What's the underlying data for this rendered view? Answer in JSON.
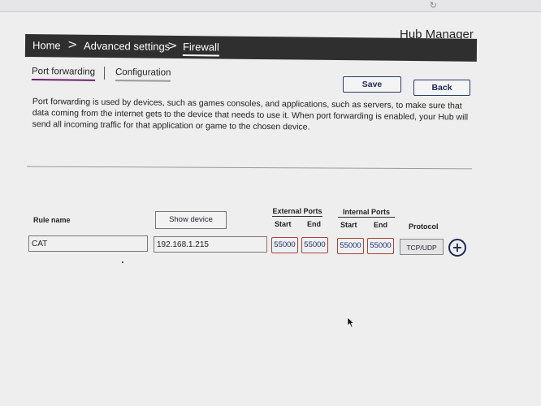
{
  "header": {
    "app_title": "Hub Manager"
  },
  "breadcrumb": {
    "items": [
      "Home",
      "Advanced settings",
      "Firewall"
    ],
    "separator": ">"
  },
  "tabs": [
    {
      "label": "Port forwarding",
      "active": true
    },
    {
      "label": "Configuration",
      "active": false
    }
  ],
  "buttons": {
    "save": "Save",
    "back": "Back"
  },
  "description": "Port forwarding is used by devices, such as games consoles, and applications, such as servers, to make sure that data coming from the internet gets to the device that needs to use it. When port forwarding is enabled, your Hub will send all incoming traffic for that application or game to the chosen device.",
  "table": {
    "rule_name_header": "Rule name",
    "show_device_label": "Show device",
    "external_ports_header": "External Ports",
    "internal_ports_header": "Internal Ports",
    "start_header": "Start",
    "end_header": "End",
    "protocol_header": "Protocol",
    "row": {
      "rule_name": "CAT",
      "device_ip": "192.168.1.215",
      "external_start": "55000",
      "external_end": "55000",
      "internal_start": "55000",
      "internal_end": "55000",
      "protocol": "TCP/UDP"
    }
  },
  "icons": {
    "reload": "reload-icon",
    "add": "plus-circle-icon",
    "cursor": "mouse-pointer-icon"
  },
  "colors": {
    "navbar": "#2f2f2f",
    "accent": "#1d2a55",
    "port_border": "#b0412f",
    "active_tab_underline": "#6b1f6b"
  }
}
